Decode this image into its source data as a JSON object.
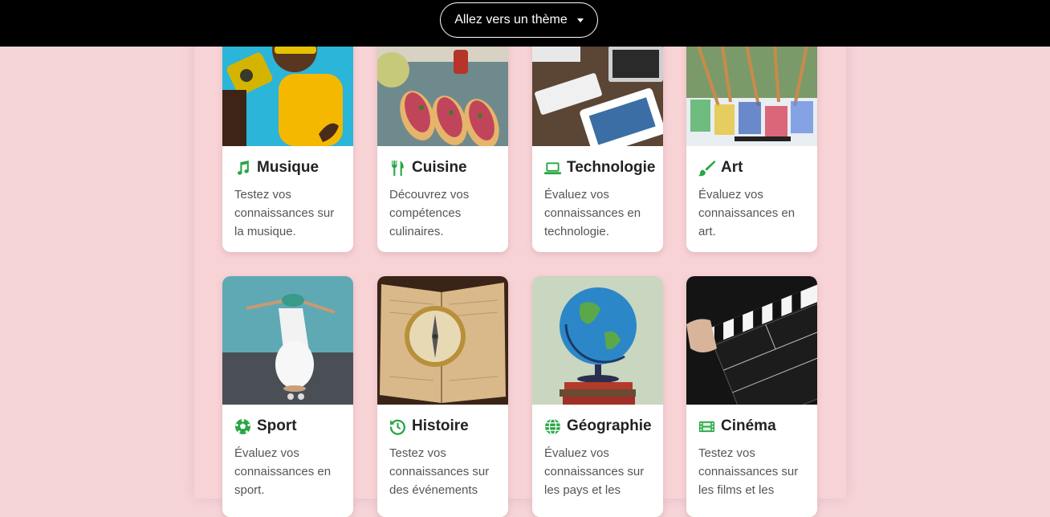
{
  "header": {
    "theme_button_label": "Allez vers un thème"
  },
  "colors": {
    "accent": "#28a745",
    "page_background": "#f6d5d9",
    "topbar": "#000000"
  },
  "themes": [
    {
      "title": "Musique",
      "icon": "music-note-icon",
      "description": "Testez vos connaissances sur la musique."
    },
    {
      "title": "Cuisine",
      "icon": "utensils-icon",
      "description": "Découvrez vos compétences culinaires."
    },
    {
      "title": "Technologie",
      "icon": "laptop-icon",
      "description": "Évaluez vos connaissances en technologie."
    },
    {
      "title": "Art",
      "icon": "paintbrush-icon",
      "description": "Évaluez vos connaissances en art."
    },
    {
      "title": "Sport",
      "icon": "soccer-ball-icon",
      "description": "Évaluez vos connaissances en sport."
    },
    {
      "title": "Histoire",
      "icon": "history-icon",
      "description": "Testez vos connaissances sur des événements"
    },
    {
      "title": "Géographie",
      "icon": "globe-icon",
      "description": "Évaluez vos connaissances sur les pays et les"
    },
    {
      "title": "Cinéma",
      "icon": "film-icon",
      "description": "Testez vos connaissances sur les films et les"
    }
  ]
}
